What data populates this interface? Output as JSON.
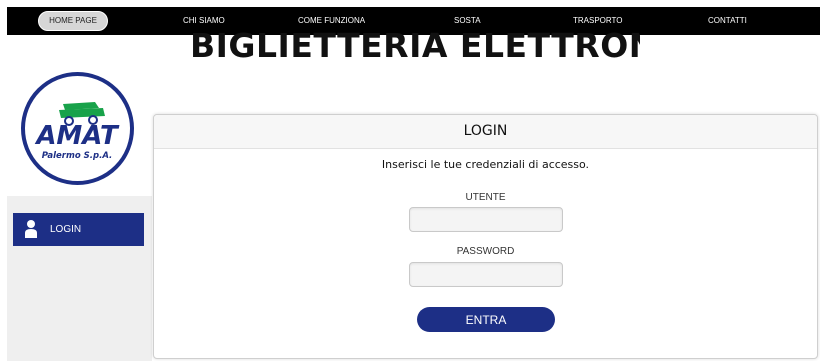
{
  "nav": {
    "items": [
      {
        "label": "HOME PAGE"
      },
      {
        "label": "CHI SIAMO"
      },
      {
        "label": "COME FUNZIONA"
      },
      {
        "label": "SOSTA"
      },
      {
        "label": "TRASPORTO"
      },
      {
        "label": "CONTATTI"
      }
    ]
  },
  "page_title": "BIGLIETTERIA ELETTRONICA",
  "logo": {
    "brand": "AMAT",
    "company": "Palermo S.p.A."
  },
  "sidebar": {
    "login_label": "LOGIN",
    "icon": "user-icon"
  },
  "login": {
    "title": "LOGIN",
    "subtitle": "Inserisci le tue credenziali di accesso.",
    "username_label": "UTENTE",
    "username_value": "",
    "password_label": "PASSWORD",
    "password_value": "",
    "submit_label": "ENTRA"
  },
  "colors": {
    "accent": "#1d2f86",
    "topbar": "#000000",
    "logo_green": "#18a24a"
  }
}
